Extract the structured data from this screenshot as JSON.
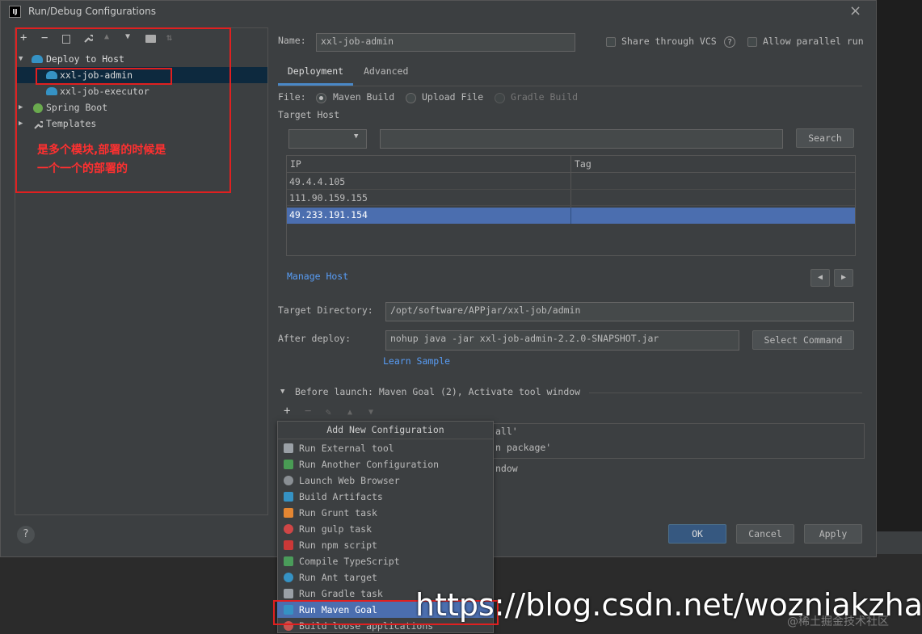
{
  "window": {
    "title": "Run/Debug Configurations",
    "close_glyph": "×"
  },
  "tree": {
    "toolbar": [
      "+",
      "−",
      "⎘",
      "🔧",
      "▲",
      "▼",
      "📁",
      "⇅"
    ],
    "items": [
      {
        "label": "Deploy to Host"
      },
      {
        "label": "xxl-job-admin"
      },
      {
        "label": "xxl-job-executor"
      },
      {
        "label": "Spring Boot"
      },
      {
        "label": "Templates"
      }
    ],
    "annotation_line1": "是多个模块,部署的时候是",
    "annotation_line2": "一个一个的部署的"
  },
  "name_label": "Name:",
  "name_value": "xxl-job-admin",
  "share_vcs_label": "Share through VCS",
  "allow_parallel_label": "Allow parallel run",
  "tabs": [
    {
      "label": "Deployment"
    },
    {
      "label": "Advanced"
    }
  ],
  "file_label": "File:",
  "file_options": [
    {
      "label": "Maven Build",
      "selected": true
    },
    {
      "label": "Upload File",
      "selected": false
    },
    {
      "label": "Gradle Build",
      "selected": false
    }
  ],
  "target_host_label": "Target Host",
  "search_button": "Search",
  "hosts_table": {
    "columns": [
      "IP",
      "Tag"
    ],
    "rows": [
      {
        "ip": "49.4.4.105",
        "tag": ""
      },
      {
        "ip": "111.90.159.155",
        "tag": ""
      },
      {
        "ip": "49.233.191.154",
        "tag": "",
        "selected": true
      }
    ]
  },
  "manage_host_link": "Manage Host",
  "nav_prev": "◀",
  "nav_next": "▶",
  "target_directory_label": "Target Directory:",
  "target_directory_value": "/opt/software/APPjar/xxl-job/admin",
  "after_deploy_label": "After deploy:",
  "after_deploy_value": "nohup java -jar xxl-job-admin-2.2.0-SNAPSHOT.jar",
  "select_command_button": "Select Command",
  "learn_sample_link": "Learn Sample",
  "before_launch_label": "Before launch: Maven Goal (2), Activate tool window",
  "before_launch_toolbar": [
    "+",
    "−",
    "✎",
    "▲",
    "▼"
  ],
  "before_launch_items_partial": [
    "all'",
    "n package'"
  ],
  "activate_partial": "ndow",
  "popup": {
    "title": "Add New Configuration",
    "items": [
      {
        "label": "Run External tool",
        "icon": "external-tool-icon",
        "color": "#9aa0a6"
      },
      {
        "label": "Run Another Configuration",
        "icon": "run-config-icon",
        "color": "#499c54"
      },
      {
        "label": "Launch Web Browser",
        "icon": "globe-icon",
        "color": "#8a8f94"
      },
      {
        "label": "Build Artifacts",
        "icon": "artifacts-icon",
        "color": "#3592c4"
      },
      {
        "label": "Run Grunt task",
        "icon": "grunt-icon",
        "color": "#e48632"
      },
      {
        "label": "Run gulp task",
        "icon": "gulp-icon",
        "color": "#cf4646"
      },
      {
        "label": "Run npm script",
        "icon": "npm-icon",
        "color": "#cb3837"
      },
      {
        "label": "Compile TypeScript",
        "icon": "typescript-icon",
        "color": "#4a9c5a"
      },
      {
        "label": "Run Ant target",
        "icon": "ant-icon",
        "color": "#3592c4"
      },
      {
        "label": "Run Gradle task",
        "icon": "gradle-icon",
        "color": "#9aa0a6"
      },
      {
        "label": "Run Maven Goal",
        "icon": "maven-icon",
        "color": "#3592c4",
        "selected": true
      },
      {
        "label": "Build loose applications",
        "icon": "loose-app-icon",
        "color": "#c75450"
      }
    ]
  },
  "ok_button": "OK",
  "cancel_button": "Cancel",
  "apply_button": "Apply",
  "help_glyph": "?",
  "watermark": "https://blog.csdn.net/wozniakzhang",
  "watermark_small": "@稀土掘金技术社区",
  "colors": {
    "selection": "#4b6eaf",
    "link": "#589df6",
    "annotation_red": "#e02020",
    "accent": "#365880"
  }
}
